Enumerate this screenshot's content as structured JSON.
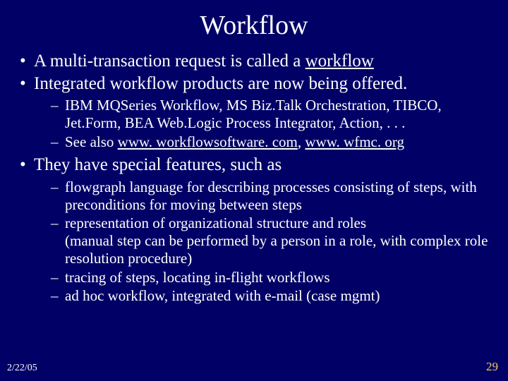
{
  "title": "Workflow",
  "b1_pre": "A multi-transaction request is called a ",
  "b1_u": "workflow",
  "b2": "Integrated workflow products are now being offered.",
  "b2s1": "IBM MQSeries Workflow, MS Biz.Talk Orchestration, TIBCO, Jet.Form, BEA Web.Logic Process Integrator, Action, . . .",
  "b2s2_pre": "See also ",
  "b2s2_link1": "www. workflowsoftware. com",
  "b2s2_mid": ", ",
  "b2s2_link2": "www. wfmc. org",
  "b3": "They have special features, such as",
  "b3s1": "flowgraph language for describing processes consisting of steps, with preconditions for moving between steps",
  "b3s2": "representation of organizational structure and roles\n(manual step can be performed by a person in a role, with complex role resolution procedure)",
  "b3s3": "tracing of steps, locating in-flight workflows",
  "b3s4": "ad hoc workflow, integrated with e-mail (case mgmt)",
  "footer_date": "2/22/05",
  "footer_page": "29"
}
